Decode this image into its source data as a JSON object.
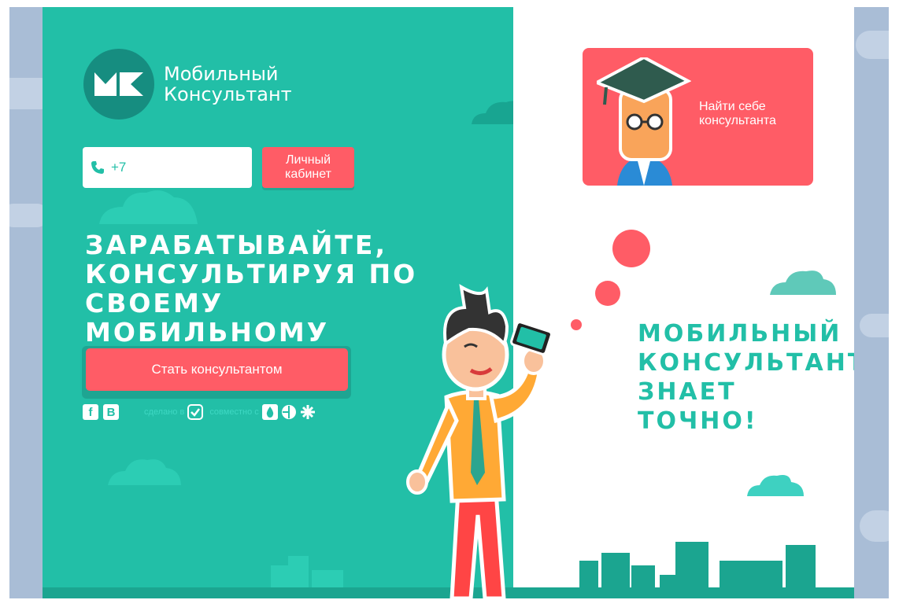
{
  "brand": {
    "line1": "Мобильный",
    "line2": "Консультант",
    "logo_letters": "МК"
  },
  "login": {
    "phone_placeholder": "+7",
    "cabinet_label_1": "Личный",
    "cabinet_label_2": "кабинет"
  },
  "hero": {
    "headline_1": "ЗАРАБАТЫВАЙТЕ,",
    "headline_2": "КОНСУЛЬТИРУЯ ПО СВОЕМУ",
    "headline_3": "МОБИЛЬНОМУ ТЕЛЕФОНУ",
    "cta_label": "Стать консультантом"
  },
  "footer": {
    "social_fb": "f",
    "social_vk": "B",
    "made_in": "сделано в",
    "together_with": "совместно с"
  },
  "card": {
    "line1": "Найти себе",
    "line2": "консультанта"
  },
  "tagline": {
    "line1": "МОБИЛЬНЫЙ",
    "line2": "КОНСУЛЬТАНТ",
    "line3": "ЗНАЕТ ТОЧНО!"
  },
  "colors": {
    "teal": "#22bfa7",
    "dark_teal": "#168d80",
    "coral": "#ff5c66",
    "backdrop": "#a9bdd6"
  }
}
